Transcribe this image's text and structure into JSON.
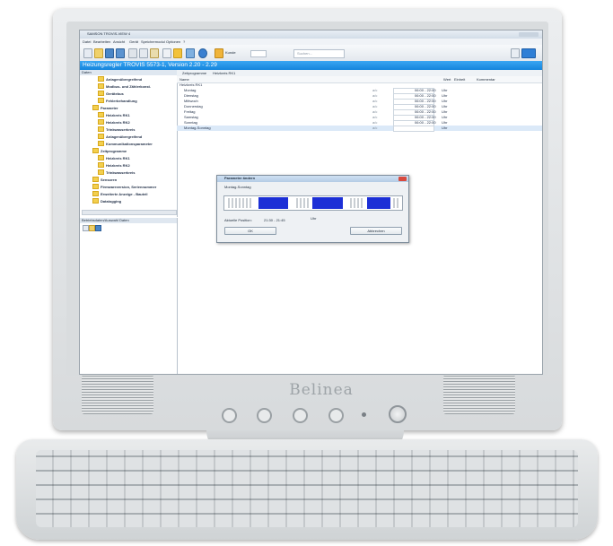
{
  "brand": "Belinea",
  "app": {
    "window_title": "SAMSON TROVIS-VIEW 4",
    "menu": [
      "Datei",
      "Bearbeiten",
      "Ansicht",
      "Gerät",
      "Speichermodul",
      "Optionen",
      "?"
    ],
    "toolbar": {
      "customer_label": "Kunde",
      "search_placeholder": "Suchen..."
    },
    "header_title": "Heizungsregler TROVIS 5573-1, Version 2.20 - 2.29",
    "nav_title": "Daten",
    "nav_items": [
      "Anlagenübergreifend",
      "Modbus- und Zählerkonst.",
      "Gerätebus",
      "Fehlerbehandlung",
      "Parameter",
      "Heizkreis RK1",
      "Heizkreis RK2",
      "Trinkwasserkreis",
      "Anlagenübergreifend",
      "Kommunikationsparameter",
      "Zeitprogramme",
      "Heizkreis RK1",
      "Heizkreis RK2",
      "Trinkwasserkreis",
      "Sensoren",
      "Firmwareversion, Seriennummer",
      "Erweiterte Anzeige - Bauteil",
      "Datalogging"
    ],
    "nav2_title": "Betriebsdaten/Auswahl Daten",
    "breadcrumb": [
      "Zeitprogramme",
      "Heizkreis RK1"
    ],
    "columns": {
      "name": "Name",
      "value": "Wert",
      "unit": "Einheit",
      "comment": "Kommentar"
    },
    "group": "Heizkreis RK1",
    "rows": [
      {
        "name": "Montag",
        "value": "06:00 - 22:00",
        "unit": "Uhr"
      },
      {
        "name": "Dienstag",
        "value": "06:00 - 22:00",
        "unit": "Uhr"
      },
      {
        "name": "Mittwoch",
        "value": "06:00 - 22:00",
        "unit": "Uhr"
      },
      {
        "name": "Donnerstag",
        "value": "06:00 - 22:00",
        "unit": "Uhr"
      },
      {
        "name": "Freitag",
        "value": "06:00 - 22:00",
        "unit": "Uhr"
      },
      {
        "name": "Samstag",
        "value": "06:00 - 22:00",
        "unit": "Uhr"
      },
      {
        "name": "Sonntag",
        "value": "06:00 - 22:00",
        "unit": "Uhr"
      },
      {
        "name": "Montag-Sonntag",
        "value": "",
        "unit": "Uhr"
      }
    ],
    "row_prefix": "a/c"
  },
  "dialog": {
    "title": "Parameter ändern",
    "subtitle": "Montag-Sonntag",
    "position_label": "Aktuelle Position:",
    "position_value": "21:30 - 21:45",
    "position_unit": "Uhr",
    "ok_label": "OK",
    "cancel_label": "Abbrechen"
  }
}
